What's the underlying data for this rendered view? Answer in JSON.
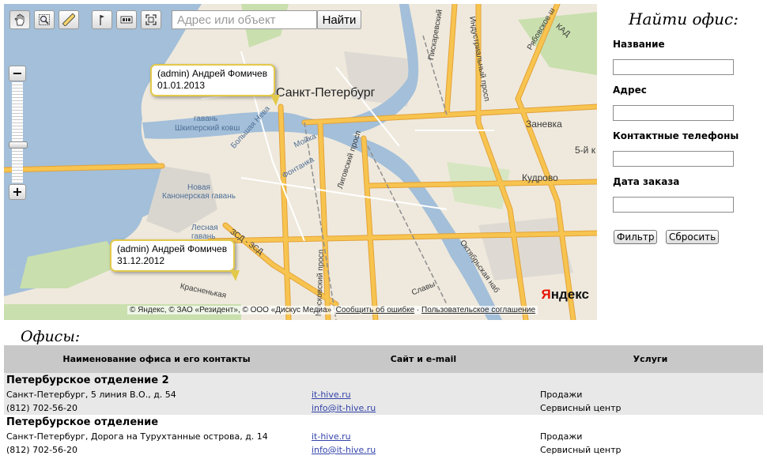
{
  "map": {
    "search_placeholder": "Адрес или объект",
    "search_button": "Найти",
    "city_label": "Санкт-Петербург",
    "labels": {
      "vasilievsky_harbor": "гавань",
      "shkiper_canal": "Шкиперский ковш",
      "new_canon_harbor": "Новая\nКанонерская гавань",
      "forest_harbor": "Лесная\nгавань",
      "zanevka": "Заневка",
      "kudrovo": "Кудрово",
      "bolshaya_neva": "Большая Нева",
      "moika": "Мойка",
      "fontanka": "Фонтанка",
      "ligovsky": "Лиговский просп",
      "moskovsky": "Московский просп",
      "oktyabrskaya": "Октябрьская наб",
      "industrial": "Индустриальный просп",
      "piskarevsky": "Пискаревский",
      "zsd": "ЗСД - ЗСД",
      "krasnenkaya": "Красненькая",
      "slavy": "Славы",
      "rybatskoe": "Рябовское ш",
      "kad": "КАД",
      "five": "5-й к"
    },
    "balloons": [
      {
        "line1": "(admin) Андрей Фомичев",
        "line2": "01.01.2013"
      },
      {
        "line1": "(admin) Андрей Фомичев",
        "line2": "31.12.2012"
      }
    ],
    "copyright": "© Яндекс, © ЗАО «Резидент», © ООО «Дискус Медиа»",
    "report_error": "Сообщить об ошибке",
    "separator": "·",
    "user_agreement": "Пользовательское соглашение",
    "logo_main": "ндекс",
    "logo_y": "Я"
  },
  "filter": {
    "title": "Найти офис:",
    "name_label": "Название",
    "address_label": "Адрес",
    "phones_label": "Контактные телефоны",
    "order_date_label": "Дата заказа",
    "filter_button": "Фильтр",
    "reset_button": "Сбросить"
  },
  "offices": {
    "title": "Офисы:",
    "headers": [
      "Наименование офиса и его контакты",
      "Сайт и e-mail",
      "Услуги"
    ],
    "rows": [
      {
        "name": "Петербурское отделение 2",
        "address": "Санкт-Петербург, 5 линия В.О., д. 54",
        "phone": "(812) 702-56-20",
        "site": "it-hive.ru",
        "email": "info@it-hive.ru",
        "service1": "Продажи",
        "service2": "Сервисный центр"
      },
      {
        "name": "Петербурское отделение",
        "address": "Санкт-Петербург, Дорога на Турухтанные острова, д. 14",
        "phone": "(812) 702-56-20",
        "site": "it-hive.ru",
        "email": "info@it-hive.ru",
        "service1": "Продажи",
        "service2": "Сервисный центр"
      }
    ]
  },
  "colors": {
    "water": "#a3bfd9",
    "land": "#efe9dd",
    "major_road": "#f7c44f",
    "road_casing": "#e3a23a",
    "balloon_border": "#e3c94a",
    "header_bg": "#c8c8c8",
    "odd_row_bg": "#e8e8e8",
    "link": "#3344aa"
  },
  "icons": [
    "hand-icon",
    "magnifier-icon",
    "ruler-icon",
    "flag-icon",
    "traffic-icon",
    "fullscreen-icon"
  ]
}
